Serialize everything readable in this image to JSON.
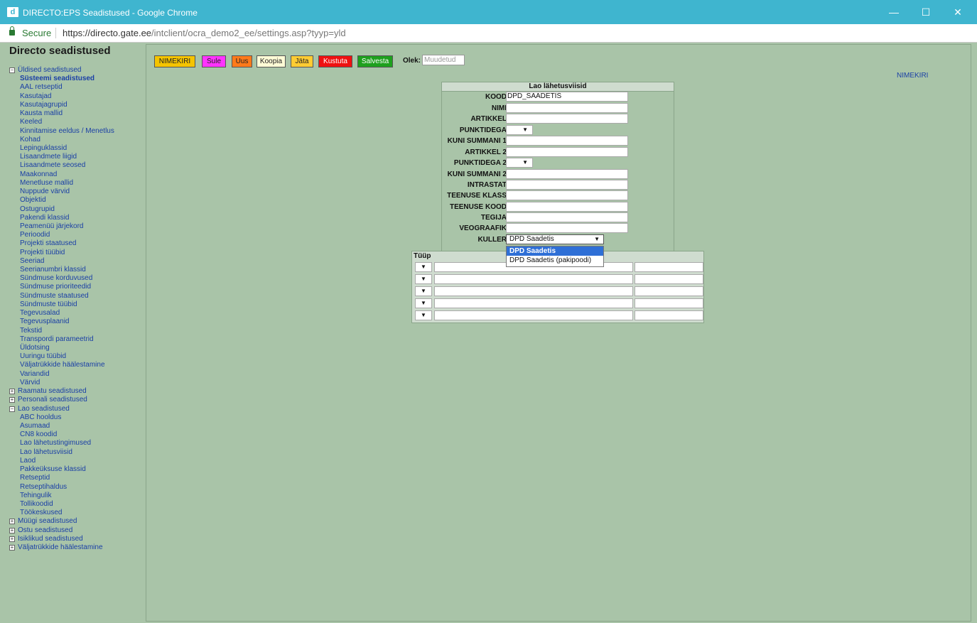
{
  "window": {
    "title": "DIRECTO:EPS Seadistused - Google Chrome",
    "icon_glyph": "d",
    "minimize": "—",
    "maximize": "☐",
    "close": "✕"
  },
  "addressbar": {
    "secure_label": "Secure",
    "url_host": "https://directo.gate.ee",
    "url_path": "/intclient/ocra_demo2_ee/settings.asp?tyyp=yld"
  },
  "sidebar": {
    "title": "Directo seadistused",
    "tree": [
      {
        "label": "Üldised seadistused",
        "level": 0,
        "toggle": "−"
      },
      {
        "label": "Süsteemi seadistused",
        "level": 1,
        "bold": true
      },
      {
        "label": "AAL retseptid",
        "level": 1
      },
      {
        "label": "Kasutajad",
        "level": 1
      },
      {
        "label": "Kasutajagrupid",
        "level": 1
      },
      {
        "label": "Kausta mallid",
        "level": 1
      },
      {
        "label": "Keeled",
        "level": 1
      },
      {
        "label": "Kinnitamise eeldus / Menetlus",
        "level": 1
      },
      {
        "label": "Kohad",
        "level": 1
      },
      {
        "label": "Lepinguklassid",
        "level": 1
      },
      {
        "label": "Lisaandmete liigid",
        "level": 1
      },
      {
        "label": "Lisaandmete seosed",
        "level": 1
      },
      {
        "label": "Maakonnad",
        "level": 1
      },
      {
        "label": "Menetluse mallid",
        "level": 1
      },
      {
        "label": "Nuppude värvid",
        "level": 1
      },
      {
        "label": "Objektid",
        "level": 1
      },
      {
        "label": "Ostugrupid",
        "level": 1
      },
      {
        "label": "Pakendi klassid",
        "level": 1
      },
      {
        "label": "Peamenüü järjekord",
        "level": 1
      },
      {
        "label": "Perioodid",
        "level": 1
      },
      {
        "label": "Projekti staatused",
        "level": 1
      },
      {
        "label": "Projekti tüübid",
        "level": 1
      },
      {
        "label": "Seeriad",
        "level": 1
      },
      {
        "label": "Seerianumbri klassid",
        "level": 1
      },
      {
        "label": "Sündmuse korduvused",
        "level": 1
      },
      {
        "label": "Sündmuse prioriteedid",
        "level": 1
      },
      {
        "label": "Sündmuste staatused",
        "level": 1
      },
      {
        "label": "Sündmuste tüübid",
        "level": 1
      },
      {
        "label": "Tegevusalad",
        "level": 1
      },
      {
        "label": "Tegevusplaanid",
        "level": 1
      },
      {
        "label": "Tekstid",
        "level": 1
      },
      {
        "label": "Transpordi parameetrid",
        "level": 1
      },
      {
        "label": "Üldotsing",
        "level": 1
      },
      {
        "label": "Uuringu tüübid",
        "level": 1
      },
      {
        "label": "Väljatrükkide häälestamine",
        "level": 1
      },
      {
        "label": "Variandid",
        "level": 1
      },
      {
        "label": "Värvid",
        "level": 1
      },
      {
        "label": "Raamatu seadistused",
        "level": 0,
        "toggle": "+"
      },
      {
        "label": "Personali seadistused",
        "level": 0,
        "toggle": "+"
      },
      {
        "label": "Lao seadistused",
        "level": 0,
        "toggle": "−"
      },
      {
        "label": "ABC hooldus",
        "level": 1
      },
      {
        "label": "Asumaad",
        "level": 1
      },
      {
        "label": "CN8 koodid",
        "level": 1
      },
      {
        "label": "Lao lähetustingimused",
        "level": 1
      },
      {
        "label": "Lao lähetusviisid",
        "level": 1
      },
      {
        "label": "Laod",
        "level": 1
      },
      {
        "label": "Pakkeüksuse klassid",
        "level": 1
      },
      {
        "label": "Retseptid",
        "level": 1
      },
      {
        "label": "Retseptihaldus",
        "level": 1
      },
      {
        "label": "Tehingulik",
        "level": 1
      },
      {
        "label": "Tollikoodid",
        "level": 1
      },
      {
        "label": "Töökeskused",
        "level": 1
      },
      {
        "label": "Müügi seadistused",
        "level": 0,
        "toggle": "+"
      },
      {
        "label": "Ostu seadistused",
        "level": 0,
        "toggle": "+"
      },
      {
        "label": "Isiklikud seadistused",
        "level": 0,
        "toggle": "+"
      },
      {
        "label": "Väljatrükkide häälestamine",
        "level": 0,
        "toggle": "+"
      }
    ]
  },
  "toolbar": {
    "buttons": [
      {
        "label": "NIMEKIRI",
        "color": "#f5c400"
      },
      {
        "label": "Sule",
        "color": "#ff33ff"
      },
      {
        "label": "Uus",
        "color": "#ff7a1a"
      },
      {
        "label": "Koopia",
        "color": "#fffbd6"
      },
      {
        "label": "Jäta",
        "color": "#ffcc33"
      },
      {
        "label": "Kustuta",
        "color": "#ee1111"
      },
      {
        "label": "Salvesta",
        "color": "#1ea01e"
      }
    ],
    "olek_label": "Olek:",
    "olek_value": "Muudetud"
  },
  "nimekiri_link": "NIMEKIRI",
  "form": {
    "heading": "Lao lähetusviisid",
    "fields": [
      {
        "label": "KOOD",
        "type": "input",
        "value": "DPD_SAADETIS"
      },
      {
        "label": "NIMI",
        "type": "input",
        "value": ""
      },
      {
        "label": "ARTIKKEL",
        "type": "input",
        "value": ""
      },
      {
        "label": "PUNKTIDEGA",
        "type": "select",
        "value": "▼"
      },
      {
        "label": "KUNI SUMMANI 1",
        "type": "input",
        "value": ""
      },
      {
        "label": "ARTIKKEL 2",
        "type": "input",
        "value": ""
      },
      {
        "label": "PUNKTIDEGA 2",
        "type": "select",
        "value": "▼"
      },
      {
        "label": "KUNI SUMMANI 2",
        "type": "input",
        "value": ""
      },
      {
        "label": "INTRASTAT",
        "type": "input",
        "value": ""
      },
      {
        "label": "TEENUSE KLASS",
        "type": "input",
        "value": ""
      },
      {
        "label": "TEENUSE KOOD",
        "type": "input",
        "value": ""
      },
      {
        "label": "TEGIJA",
        "type": "input",
        "value": ""
      },
      {
        "label": "VEOGRAAFIK",
        "type": "input",
        "value": ""
      },
      {
        "label": "KULLER",
        "type": "selectwide",
        "value": "DPD Saadetis"
      }
    ],
    "kuller_options": [
      "DPD Saadetis",
      "DPD Saadetis (pakipoodi)"
    ]
  },
  "tyyp": {
    "heading": "Tüüp",
    "rows": 5,
    "select_arrow": "▼"
  }
}
